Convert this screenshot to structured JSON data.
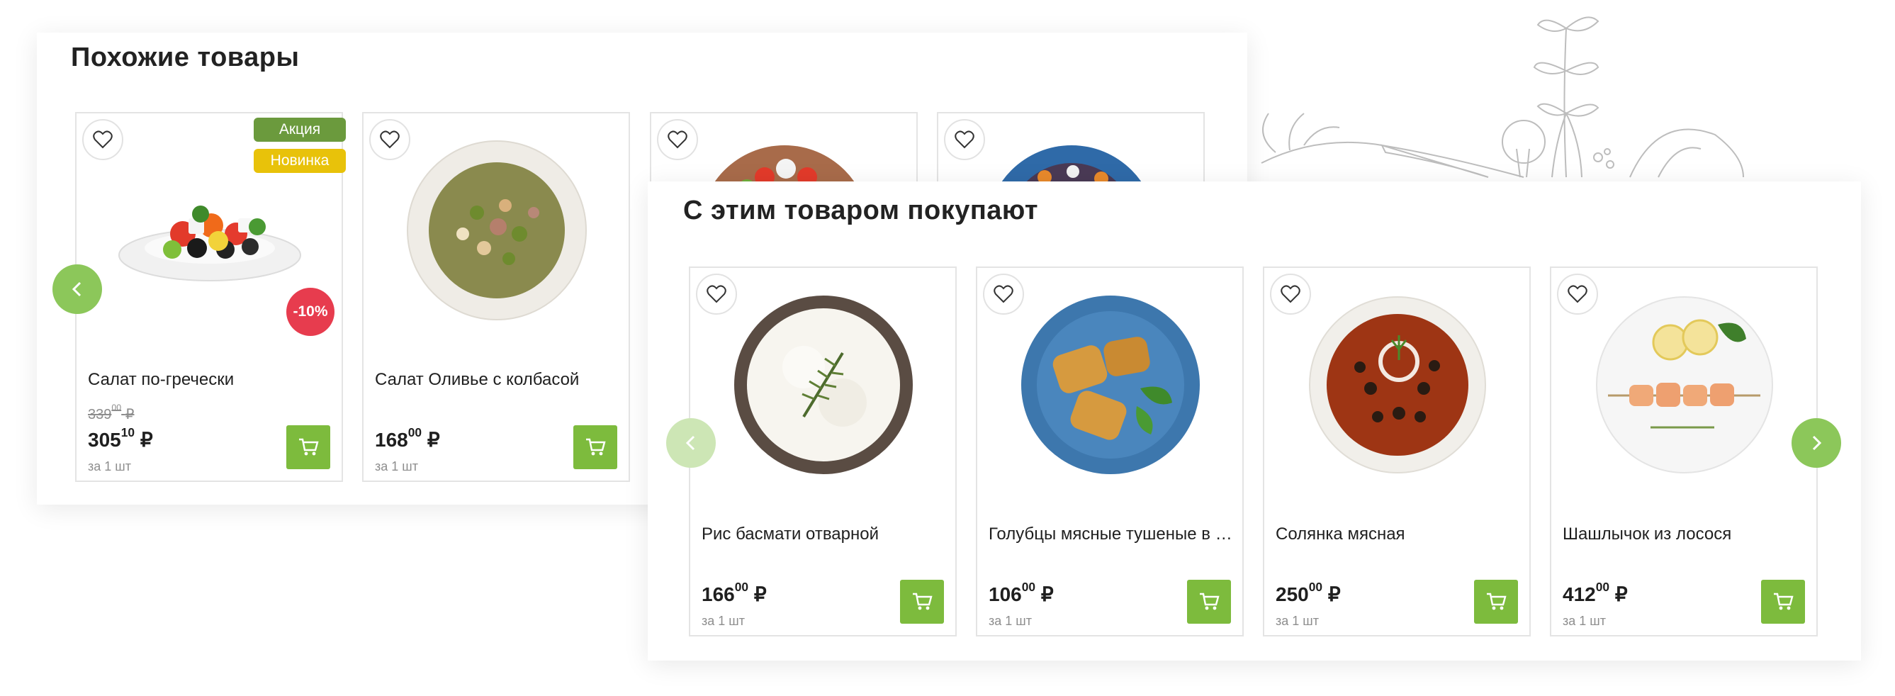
{
  "similar": {
    "title": "Похожие товары",
    "products": [
      {
        "name": "Салат по-гречески",
        "old_int": "339",
        "old_frac": "00",
        "old_cur": "₽",
        "price_int": "305",
        "price_frac": "10",
        "currency": "₽",
        "unit": "за 1 шт",
        "badge_promo": "Акция",
        "badge_new": "Новинка",
        "discount": "-10%",
        "image": "greek-salad"
      },
      {
        "name": "Салат Оливье с колбасой",
        "price_int": "168",
        "price_frac": "00",
        "currency": "₽",
        "unit": "за 1 шт",
        "image": "olivier-salad"
      },
      {
        "name": "",
        "image": "vegetable-salad"
      },
      {
        "name": "",
        "image": "rice-dish"
      }
    ]
  },
  "bought": {
    "title": "С этим товаром покупают",
    "products": [
      {
        "name": "Рис басмати отварной",
        "price_int": "166",
        "price_frac": "00",
        "currency": "₽",
        "unit": "за 1 шт",
        "image": "boiled-rice"
      },
      {
        "name": "Голубцы мясные тушеные в сметане",
        "price_int": "106",
        "price_frac": "00",
        "currency": "₽",
        "unit": "за 1 шт",
        "image": "cabbage-rolls"
      },
      {
        "name": "Солянка мясная",
        "price_int": "250",
        "price_frac": "00",
        "currency": "₽",
        "unit": "за 1 шт",
        "image": "solyanka-soup"
      },
      {
        "name": "Шашлычок из лосося",
        "price_int": "412",
        "price_frac": "00",
        "currency": "₽",
        "unit": "за 1 шт",
        "image": "salmon-skewer"
      }
    ]
  },
  "colors": {
    "accent": "#7dbb3d",
    "promo": "#6b9a3d",
    "new": "#e8c20a",
    "discount": "#e73c4e"
  }
}
